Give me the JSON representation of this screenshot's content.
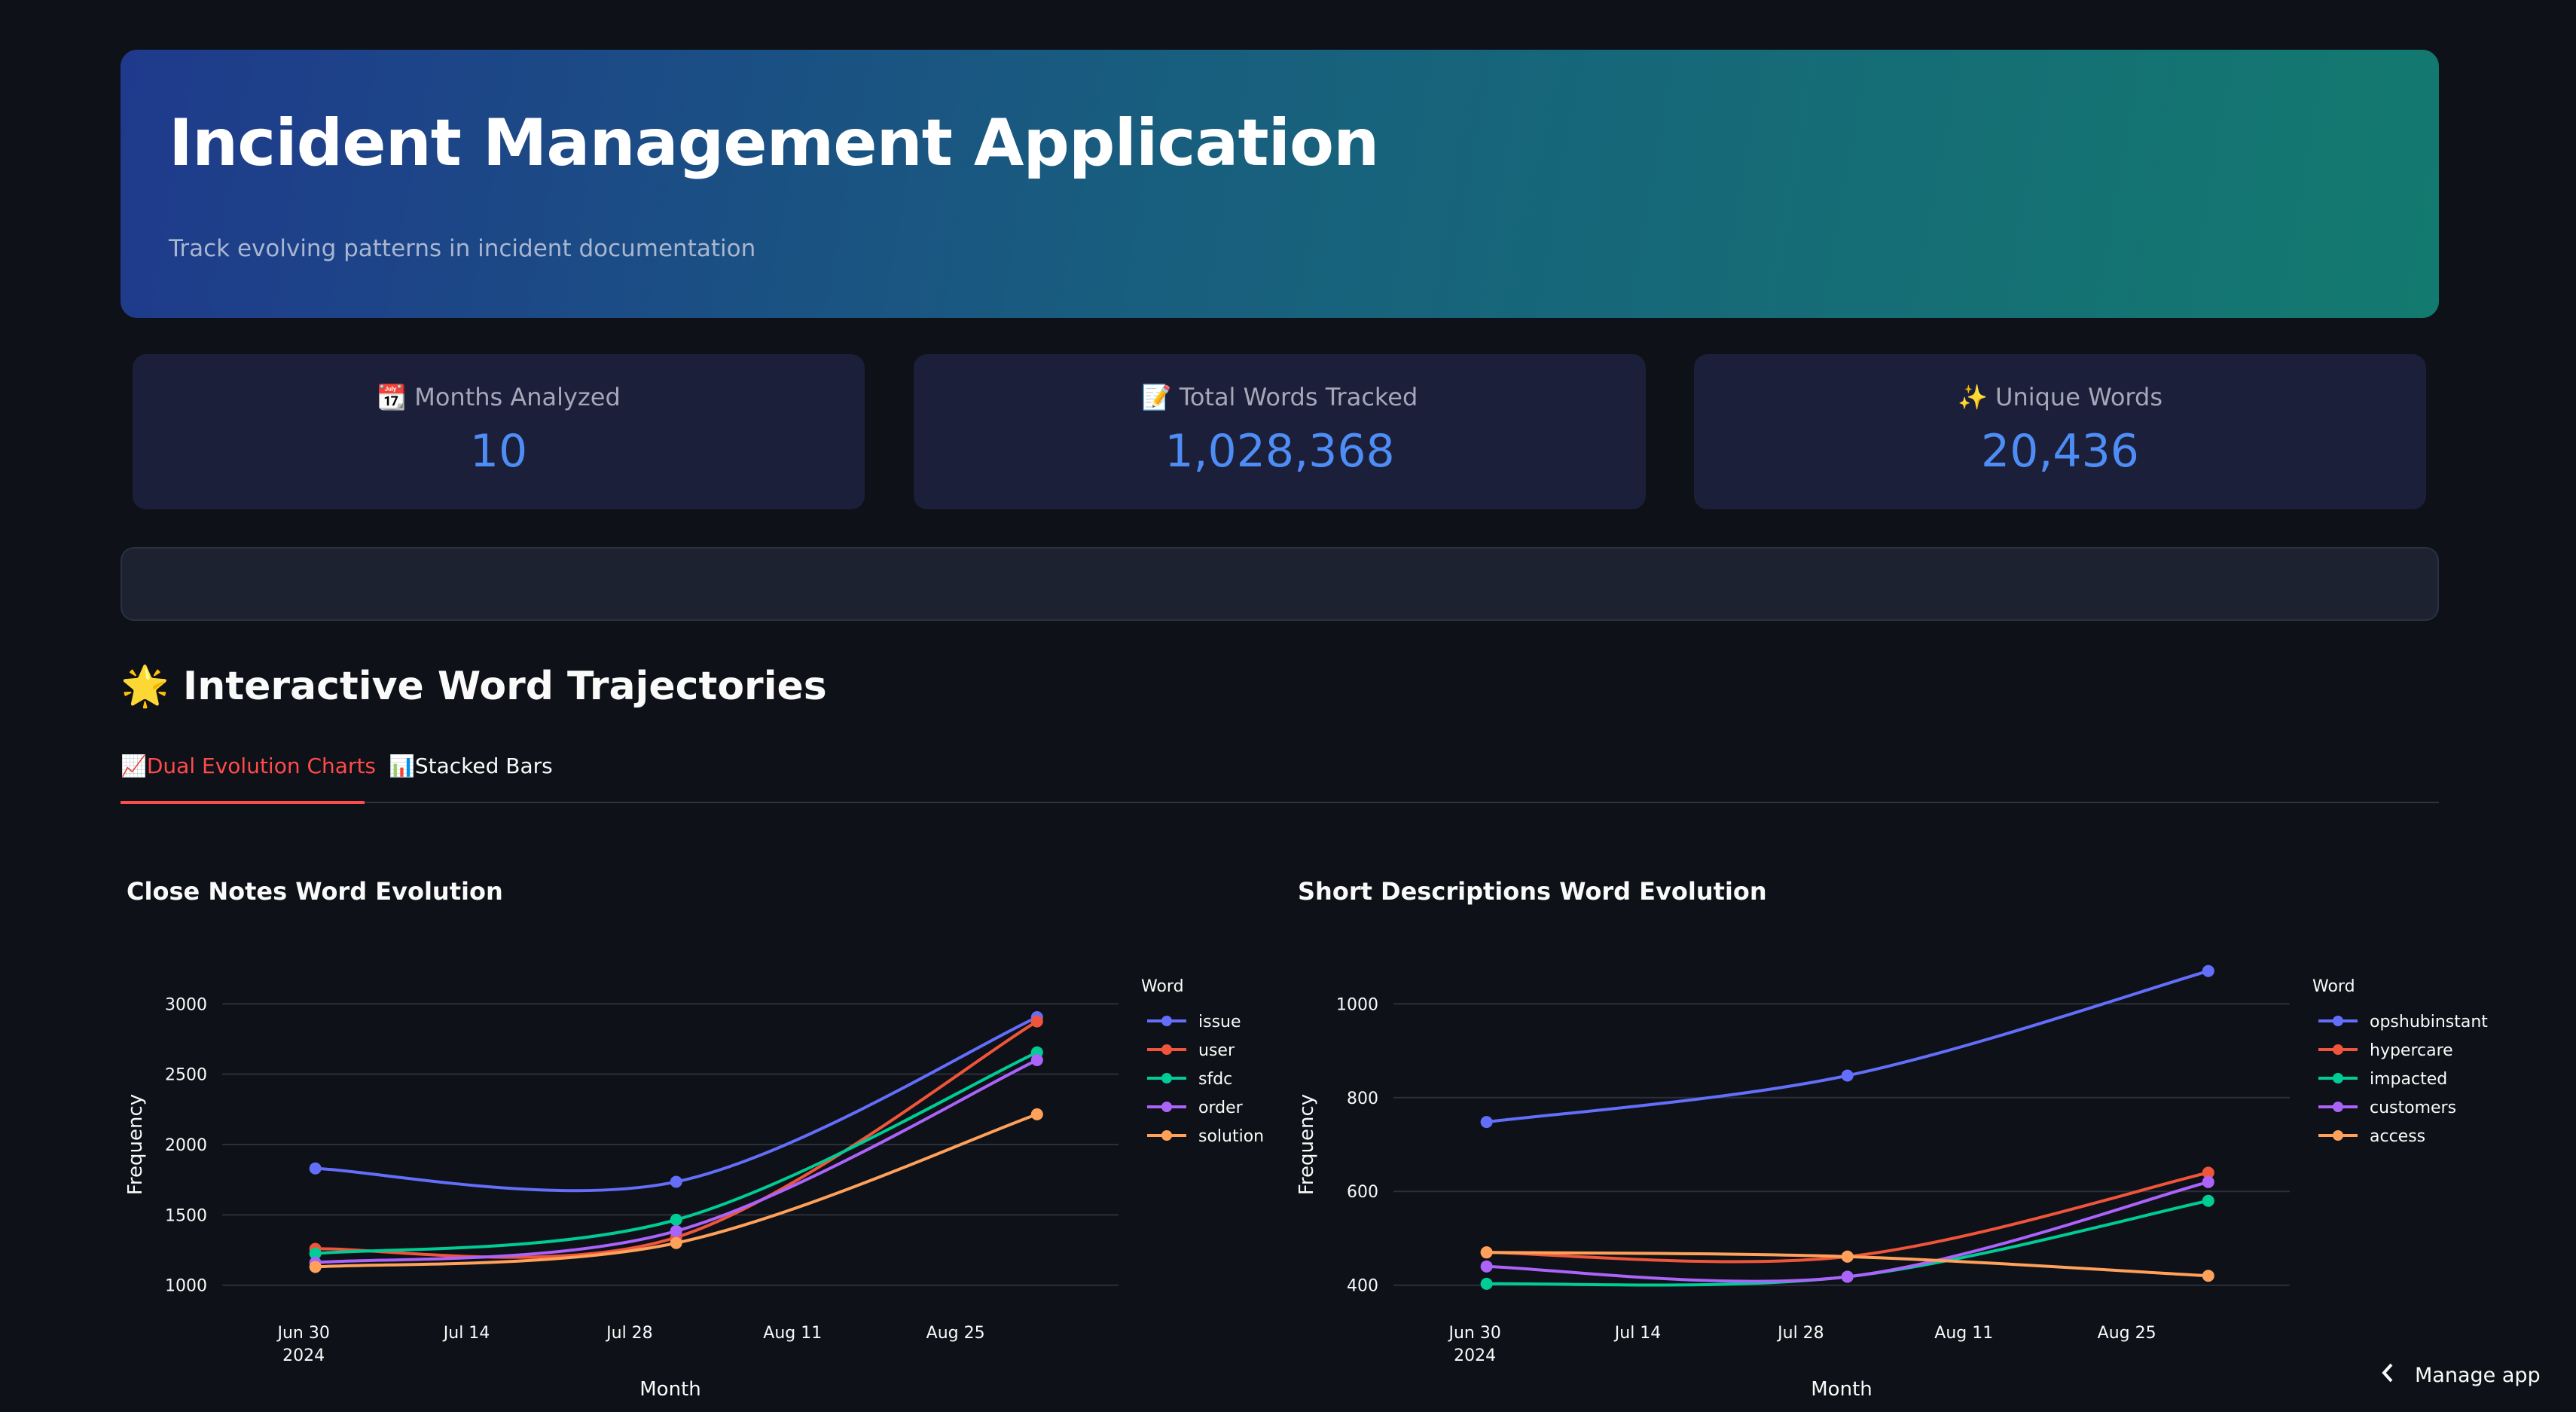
{
  "header": {
    "title": "Incident Management Application",
    "subtitle": "Track evolving patterns in incident documentation"
  },
  "metrics": [
    {
      "icon": "📆",
      "label": "Months Analyzed",
      "value": "10"
    },
    {
      "icon": "📝",
      "label": "Total Words Tracked",
      "value": "1,028,368"
    },
    {
      "icon": "✨",
      "label": "Unique Words",
      "value": "20,436"
    }
  ],
  "section": {
    "icon": "🌟",
    "title": "Interactive Word Trajectories"
  },
  "tabs": [
    {
      "icon": "📈",
      "label": "Dual Evolution Charts",
      "active": true
    },
    {
      "icon": "📊",
      "label": "Stacked Bars",
      "active": false
    }
  ],
  "footer": {
    "manage_label": "Manage app"
  },
  "colors": {
    "accent": "#ff4b4b",
    "metric_value": "#4e8df5",
    "series": [
      "#636efa",
      "#ef553b",
      "#00cc96",
      "#ab63fa",
      "#ffa15a"
    ]
  },
  "chart_data": [
    {
      "type": "line",
      "title": "Close Notes Word Evolution",
      "xlabel": "Month",
      "ylabel": "Frequency",
      "legend_title": "Word",
      "x": [
        "2024-07-01",
        "2024-08-01",
        "2024-09-01"
      ],
      "x_ticks": [
        "Jun 30|2024",
        "Jul 14",
        "Jul 28",
        "Aug 11",
        "Aug 25"
      ],
      "x_tick_dates": [
        "2024-06-30",
        "2024-07-14",
        "2024-07-28",
        "2024-08-11",
        "2024-08-25"
      ],
      "y_ticks": [
        1000,
        1500,
        2000,
        2500,
        3000
      ],
      "ylim": [
        1000,
        3000
      ],
      "grid": true,
      "legend_position": "right",
      "series": [
        {
          "name": "issue",
          "values": [
            1830,
            1735,
            2905
          ]
        },
        {
          "name": "user",
          "values": [
            1258,
            1340,
            2875
          ]
        },
        {
          "name": "sfdc",
          "values": [
            1225,
            1465,
            2655
          ]
        },
        {
          "name": "order",
          "values": [
            1160,
            1385,
            2600
          ]
        },
        {
          "name": "solution",
          "values": [
            1130,
            1300,
            2215
          ]
        }
      ]
    },
    {
      "type": "line",
      "title": "Short Descriptions Word Evolution",
      "xlabel": "Month",
      "ylabel": "Frequency",
      "legend_title": "Word",
      "x": [
        "2024-07-01",
        "2024-08-01",
        "2024-09-01"
      ],
      "x_ticks": [
        "Jun 30|2024",
        "Jul 14",
        "Jul 28",
        "Aug 11",
        "Aug 25"
      ],
      "x_tick_dates": [
        "2024-06-30",
        "2024-07-14",
        "2024-07-28",
        "2024-08-11",
        "2024-08-25"
      ],
      "y_ticks": [
        400,
        600,
        800,
        1000
      ],
      "ylim": [
        400,
        1000
      ],
      "grid": true,
      "legend_position": "right",
      "series": [
        {
          "name": "opshubinstant",
          "values": [
            748,
            847,
            1070
          ]
        },
        {
          "name": "hypercare",
          "values": [
            470,
            461,
            640
          ]
        },
        {
          "name": "impacted",
          "values": [
            403,
            418,
            580
          ]
        },
        {
          "name": "customers",
          "values": [
            440,
            418,
            620
          ]
        },
        {
          "name": "access",
          "values": [
            470,
            461,
            420
          ]
        }
      ]
    }
  ]
}
